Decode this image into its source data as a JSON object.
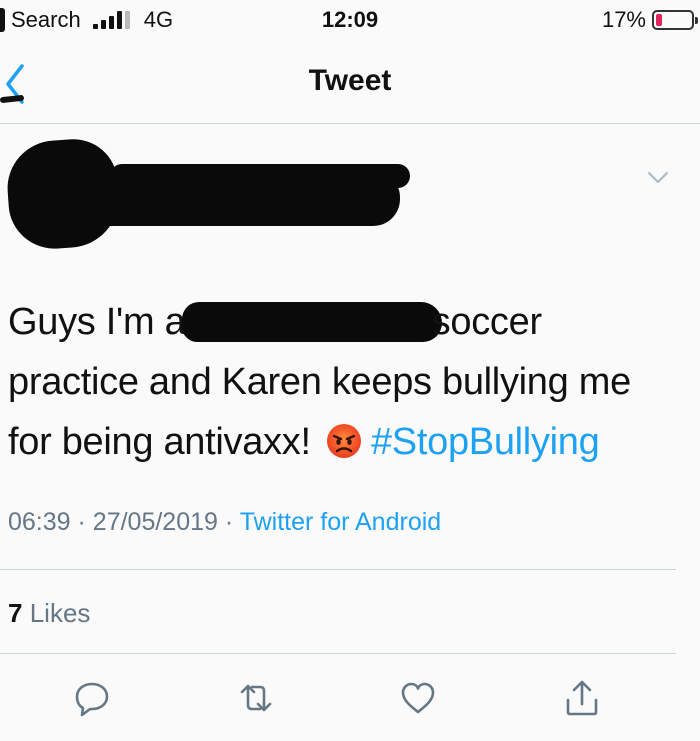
{
  "status_bar": {
    "carrier": "Search",
    "network": "4G",
    "time": "12:09",
    "battery_percent": "17%",
    "battery_level": 0.17,
    "battery_color": "#e0245e"
  },
  "nav": {
    "title": "Tweet",
    "back_icon": "chevron-left-icon",
    "accent_color": "#1da1f2"
  },
  "tweet": {
    "text_part1": "Guys I'm at",
    "text_part2": "soccer practice and Karen keeps bullying me for being antivaxx!",
    "emoji": "angry-face-emoji",
    "hashtag": "#StopBullying",
    "time": "06:39",
    "date": "27/05/2019",
    "separator": "·",
    "source": "Twitter for Android",
    "likes_count": "7",
    "likes_label": "Likes"
  },
  "actions": [
    {
      "icon": "reply-icon"
    },
    {
      "icon": "retweet-icon"
    },
    {
      "icon": "like-icon"
    },
    {
      "icon": "share-icon"
    }
  ]
}
